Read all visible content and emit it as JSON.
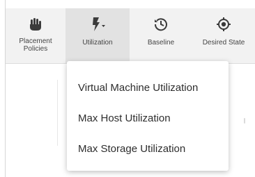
{
  "toolbar": {
    "items": [
      {
        "label_line1": "Placement",
        "label_line2": "Policies",
        "icon": "hand-icon"
      },
      {
        "label": "Utilization",
        "icon": "lightning-bolt-icon"
      },
      {
        "label": "Baseline",
        "icon": "history-clock-icon"
      },
      {
        "label": "Desired State",
        "icon": "target-icon"
      }
    ]
  },
  "dropdown": {
    "items": [
      "Virtual Machine Utilization",
      "Max Host Utilization",
      "Max Storage Utilization"
    ]
  }
}
